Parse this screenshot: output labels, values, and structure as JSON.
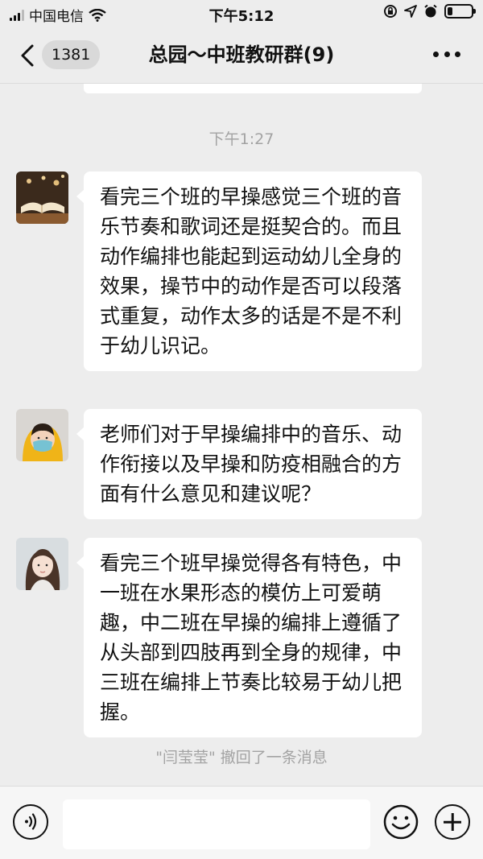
{
  "status_bar": {
    "carrier": "中国电信",
    "time": "下午5:12"
  },
  "header": {
    "back_count": "1381",
    "title": "总园～中班教研群(9)"
  },
  "chat": {
    "timestamp": "下午1:27",
    "messages": [
      {
        "avatar": "book-photo-avatar",
        "text": "看完三个班的早操感觉三个班的音乐节奏和歌词还是挺契合的。而且动作编排也能起到运动幼儿全身的效果，操节中的动作是否可以段落式重复，动作太多的话是不是不利于幼儿识记。"
      },
      {
        "avatar": "masked-child-avatar",
        "text": "老师们对于早操编排中的音乐、动作衔接以及早操和防疫相融合的方面有什么意见和建议呢？"
      },
      {
        "avatar": "girl-portrait-avatar",
        "text": "看完三个班早操觉得各有特色，中一班在水果形态的模仿上可爱萌趣，中二班在早操的编排上遵循了从头部到四肢再到全身的规律，中三班在编排上节奏比较易于幼儿把握。"
      }
    ],
    "system_notice": "\"闫莹莹\" 撤回了一条消息"
  },
  "input_bar": {
    "placeholder": ""
  }
}
